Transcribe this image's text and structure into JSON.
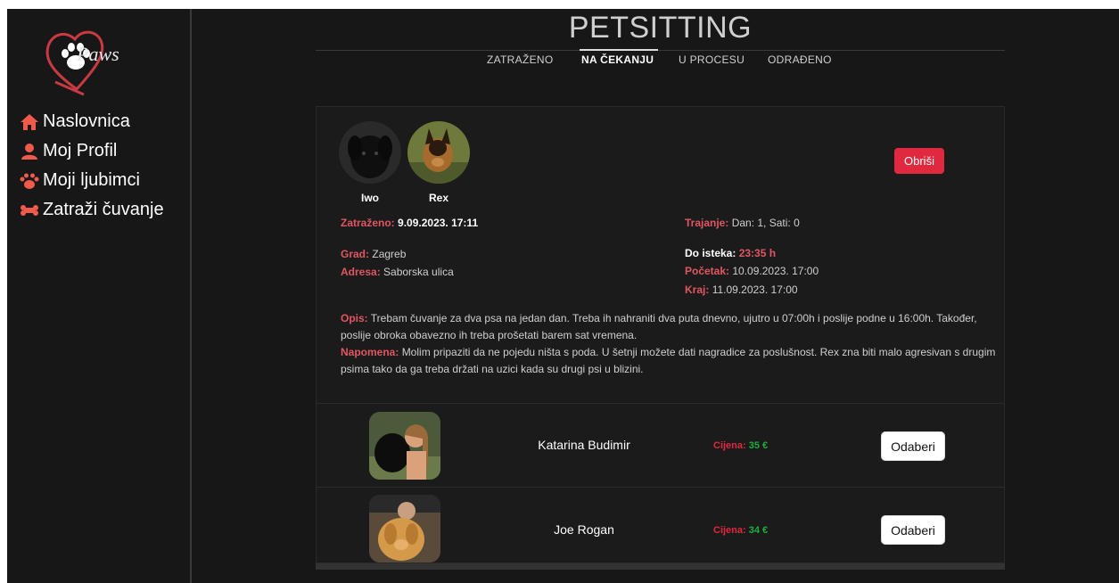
{
  "app": {
    "logo_text": "Paws",
    "page_title": "PETSITTING"
  },
  "sidebar": {
    "items": [
      {
        "label": "Naslovnica",
        "icon": "home-icon",
        "color": "#f05a4a"
      },
      {
        "label": "Moj Profil",
        "icon": "user-icon",
        "color": "#f05a4a"
      },
      {
        "label": "Moji ljubimci",
        "icon": "paw-icon",
        "color": "#f05a4a"
      },
      {
        "label": "Zatraži čuvanje",
        "icon": "bone-icon",
        "color": "#f05a4a"
      }
    ]
  },
  "tabs": [
    {
      "label": "ZATRAŽENO",
      "active": false
    },
    {
      "label": "NA ČEKANJU",
      "active": true
    },
    {
      "label": "U PROCESU",
      "active": false
    },
    {
      "label": "ODRAĐENO",
      "active": false
    }
  ],
  "request": {
    "pets": [
      {
        "name": "Iwo"
      },
      {
        "name": "Rex"
      }
    ],
    "delete_label": "Obriši",
    "requested": {
      "label": "Zatraženo:",
      "value": "9.09.2023. 17:11"
    },
    "duration": {
      "label": "Trajanje:",
      "value": "Dan: 1, Sati: 0"
    },
    "city": {
      "label": "Grad:",
      "value": "Zagreb"
    },
    "address": {
      "label": "Adresa:",
      "value": "Saborska ulica"
    },
    "expires": {
      "label": "Do isteka:",
      "value": "23:35 h"
    },
    "start": {
      "label": "Početak:",
      "value": "10.09.2023. 17:00"
    },
    "end": {
      "label": "Kraj:",
      "value": "11.09.2023. 17:00"
    },
    "description": {
      "label": "Opis:",
      "value": "Trebam čuvanje za dva psa na jedan dan. Treba ih nahraniti dva puta dnevno, ujutro u 07:00h i poslije podne u 16:00h. Također, poslije obroka obavezno ih treba prošetati barem sat vremena."
    },
    "note": {
      "label": "Napomena:",
      "value": "Molim pripaziti da ne pojedu ništa s poda. U šetnji možete dati nagradice za poslušnost. Rex zna biti malo agresivan s drugim psima tako da ga treba držati na uzici kada su drugi psi u blizini."
    }
  },
  "sitters": [
    {
      "name": "Katarina Budimir",
      "price_label": "Cijena:",
      "price": "35 €",
      "select_label": "Odaberi"
    },
    {
      "name": "Joe Rogan",
      "price_label": "Cijena:",
      "price": "34 €",
      "select_label": "Odaberi"
    }
  ],
  "colors": {
    "accent_red": "#e0293f",
    "label_red": "#e05662",
    "price_green": "#1fae3b",
    "background": "#171717"
  }
}
